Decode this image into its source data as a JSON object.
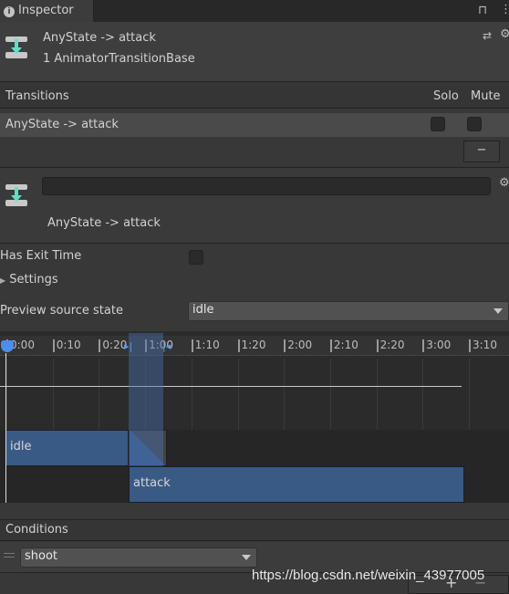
{
  "tab": {
    "title": "Inspector",
    "icon": "info-icon"
  },
  "header": {
    "title": "AnyState -> attack",
    "subtitle": "1 AnimatorTransitionBase"
  },
  "transitions": {
    "header": "Transitions",
    "solo": "Solo",
    "mute": "Mute",
    "rows": [
      {
        "label": "AnyState -> attack",
        "solo": false,
        "mute": false
      }
    ],
    "remove_label": "−"
  },
  "transition": {
    "name_value": "",
    "title": "AnyState -> attack"
  },
  "has_exit_time": {
    "label": "Has Exit Time",
    "checked": false
  },
  "settings": {
    "label": "Settings",
    "expanded": false
  },
  "preview": {
    "label": "Preview source state",
    "value": "idle"
  },
  "timeline": {
    "ticks": [
      "0:00",
      "0:10",
      "0:20",
      "1:00",
      "1:10",
      "1:20",
      "2:00",
      "2:10",
      "2:20",
      "3:00",
      "3:10"
    ],
    "source_clip": "idle",
    "dest_clip": "attack",
    "accent": "#3a5a86"
  },
  "conditions": {
    "header": "Conditions",
    "items": [
      {
        "parameter": "shoot"
      }
    ],
    "add_label": "+",
    "remove_label": "−"
  },
  "watermark": "https://blog.csdn.net/weixin_43977005"
}
